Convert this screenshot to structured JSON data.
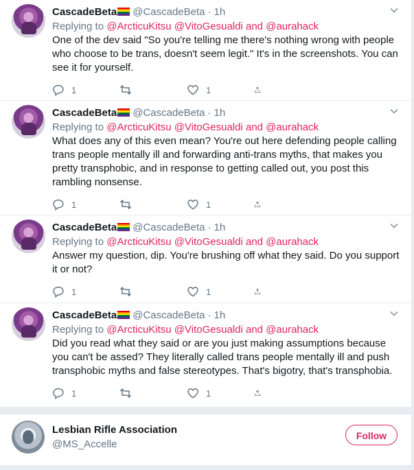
{
  "tweets": [
    {
      "name": "CascadeBeta",
      "handle": "@CascadeBeta",
      "time": "1h",
      "reply_prefix": "Replying to ",
      "reply_mentions": "@ArcticuKitsu @VitoGesualdi and @aurahack",
      "text": "One of the dev said \"So you're telling me there's nothing wrong with people who choose to be trans, doesn't seem legit.\" It's in the screenshots. You can see it for yourself.",
      "replies": "1",
      "likes": "1"
    },
    {
      "name": "CascadeBeta",
      "handle": "@CascadeBeta",
      "time": "1h",
      "reply_prefix": "Replying to ",
      "reply_mentions": "@ArcticuKitsu @VitoGesualdi and @aurahack",
      "text": "What does any of this even mean? You're out here defending people calling trans people mentally ill and forwarding anti-trans myths, that makes you pretty transphobic, and in response to getting called out, you post this rambling nonsense.",
      "replies": "1",
      "likes": "1"
    },
    {
      "name": "CascadeBeta",
      "handle": "@CascadeBeta",
      "time": "1h",
      "reply_prefix": "Replying to ",
      "reply_mentions": "@ArcticuKitsu @VitoGesualdi and @aurahack",
      "text": "Answer my question, dip. You're brushing off what they said. Do you support it or not?",
      "replies": "1",
      "likes": "1"
    },
    {
      "name": "CascadeBeta",
      "handle": "@CascadeBeta",
      "time": "1h",
      "reply_prefix": "Replying to ",
      "reply_mentions": "@ArcticuKitsu @VitoGesualdi and @aurahack",
      "text": "Did you read what they said or are you just making assumptions because you can't be assed? They literally called trans people mentally ill and push transphobic myths and false stereotypes. That's bigotry, that's transphobia.",
      "replies": "1",
      "likes": "1"
    }
  ],
  "dot": "·",
  "follow_card": {
    "name": "Lesbian Rifle Association",
    "handle": "@MS_Accelle",
    "button": "Follow"
  },
  "colors": {
    "mention": "#e0245e",
    "muted": "#657786",
    "follow": "#e0245e"
  },
  "icons": {
    "reply": "reply-icon",
    "retweet": "retweet-icon",
    "like": "heart-icon",
    "share": "share-icon",
    "more": "chevron-down-icon"
  }
}
